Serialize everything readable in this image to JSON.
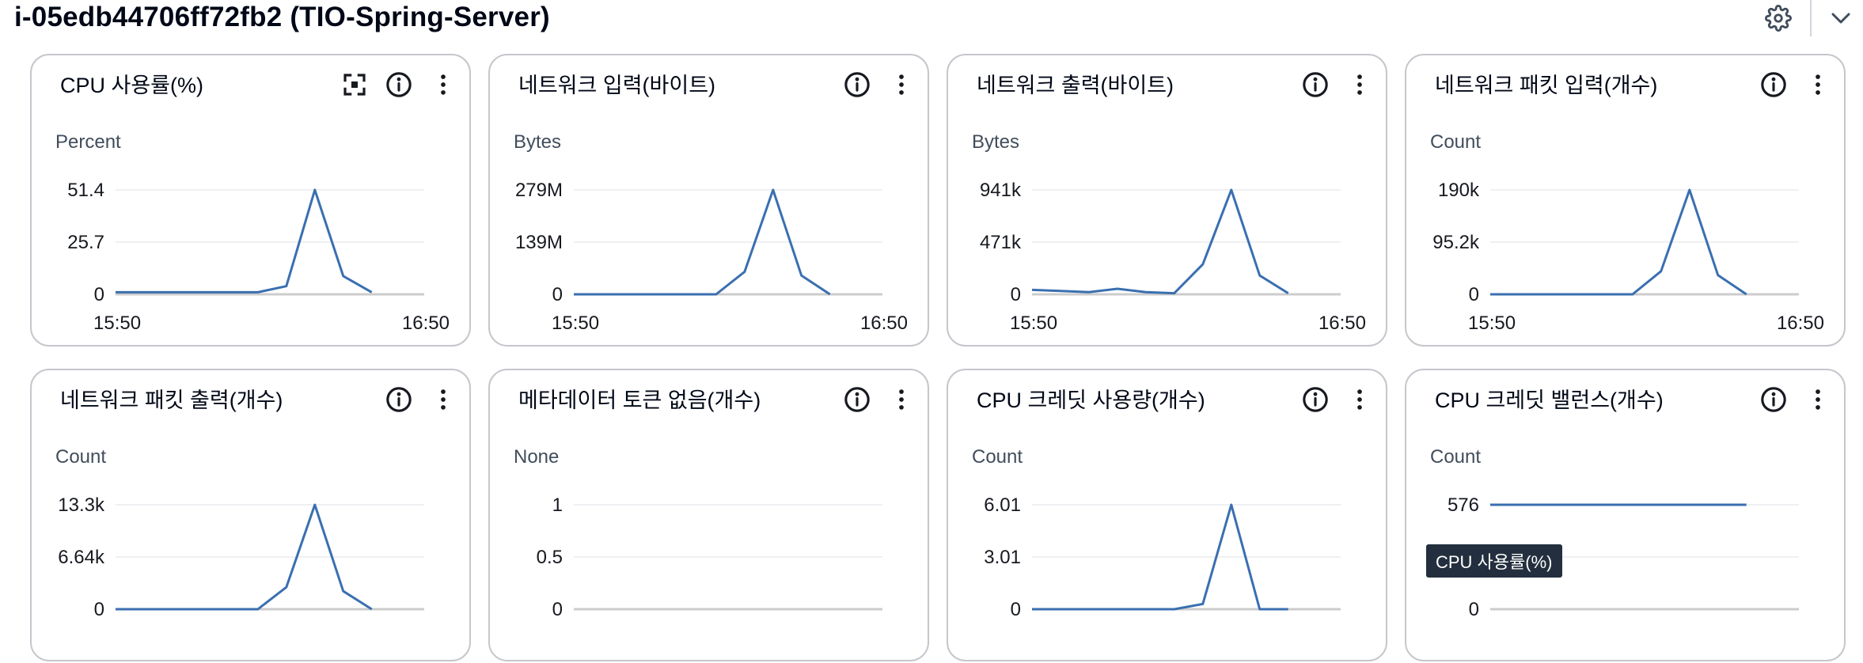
{
  "page": {
    "title": "i-05edb44706ff72fb2 (TIO-Spring-Server)",
    "settings_icon": "gear-icon",
    "collapse_icon": "chevron-down-icon"
  },
  "widgets": [
    {
      "title": "CPU 사용률(%)",
      "unit": "Percent",
      "has_fullscreen": true,
      "y_ticks": [
        "51.4",
        "25.7",
        "0"
      ],
      "x_ticks": [
        "15:50",
        "16:50"
      ],
      "ymax": 51.4,
      "line": [
        1,
        1,
        1,
        1,
        1,
        1,
        4,
        51.4,
        9,
        1
      ]
    },
    {
      "title": "네트워크 입력(바이트)",
      "unit": "Bytes",
      "has_fullscreen": false,
      "y_ticks": [
        "279M",
        "139M",
        "0"
      ],
      "x_ticks": [
        "15:50",
        "16:50"
      ],
      "ymax": 279,
      "line": [
        0,
        0,
        0,
        0,
        0,
        0,
        60,
        279,
        50,
        0
      ]
    },
    {
      "title": "네트워크 출력(바이트)",
      "unit": "Bytes",
      "has_fullscreen": false,
      "y_ticks": [
        "941k",
        "471k",
        "0"
      ],
      "x_ticks": [
        "15:50",
        "16:50"
      ],
      "ymax": 941,
      "line": [
        40,
        30,
        20,
        50,
        20,
        10,
        270,
        941,
        170,
        10
      ]
    },
    {
      "title": "네트워크 패킷 입력(개수)",
      "unit": "Count",
      "has_fullscreen": false,
      "y_ticks": [
        "190k",
        "95.2k",
        "0"
      ],
      "x_ticks": [
        "15:50",
        "16:50"
      ],
      "ymax": 190,
      "line": [
        0,
        0,
        0,
        0,
        0,
        0,
        42,
        190,
        35,
        0
      ]
    },
    {
      "title": "네트워크 패킷 출력(개수)",
      "unit": "Count",
      "has_fullscreen": false,
      "y_ticks": [
        "13.3k",
        "6.64k",
        "0"
      ],
      "x_ticks": [],
      "ymax": 13.3,
      "line": [
        0,
        0,
        0,
        0,
        0,
        0,
        2.8,
        13.3,
        2.3,
        0
      ]
    },
    {
      "title": "메타데이터 토큰 없음(개수)",
      "unit": "None",
      "has_fullscreen": false,
      "y_ticks": [
        "1",
        "0.5",
        "0"
      ],
      "x_ticks": [],
      "ymax": 1,
      "line": []
    },
    {
      "title": "CPU 크레딧 사용량(개수)",
      "unit": "Count",
      "has_fullscreen": false,
      "y_ticks": [
        "6.01",
        "3.01",
        "0"
      ],
      "x_ticks": [],
      "ymax": 6.01,
      "line": [
        0,
        0,
        0,
        0,
        0,
        0,
        0.3,
        6.01,
        0,
        0
      ]
    },
    {
      "title": "CPU 크레딧 밸런스(개수)",
      "unit": "Count",
      "has_fullscreen": false,
      "y_ticks": [
        "576",
        "",
        "0"
      ],
      "x_ticks": [],
      "ymax": 576,
      "line": [
        576,
        576,
        576,
        576,
        576,
        576,
        576,
        576,
        576,
        576
      ]
    }
  ],
  "tooltip": "CPU 사용률(%)",
  "colors": {
    "line": "#3a6fb0",
    "grid": "#e9ebed",
    "baseline": "#cccccc",
    "border": "#c6c6cd"
  },
  "icons": {
    "fullscreen": "fullscreen-icon",
    "info": "info-icon",
    "more": "more-vertical-icon"
  }
}
